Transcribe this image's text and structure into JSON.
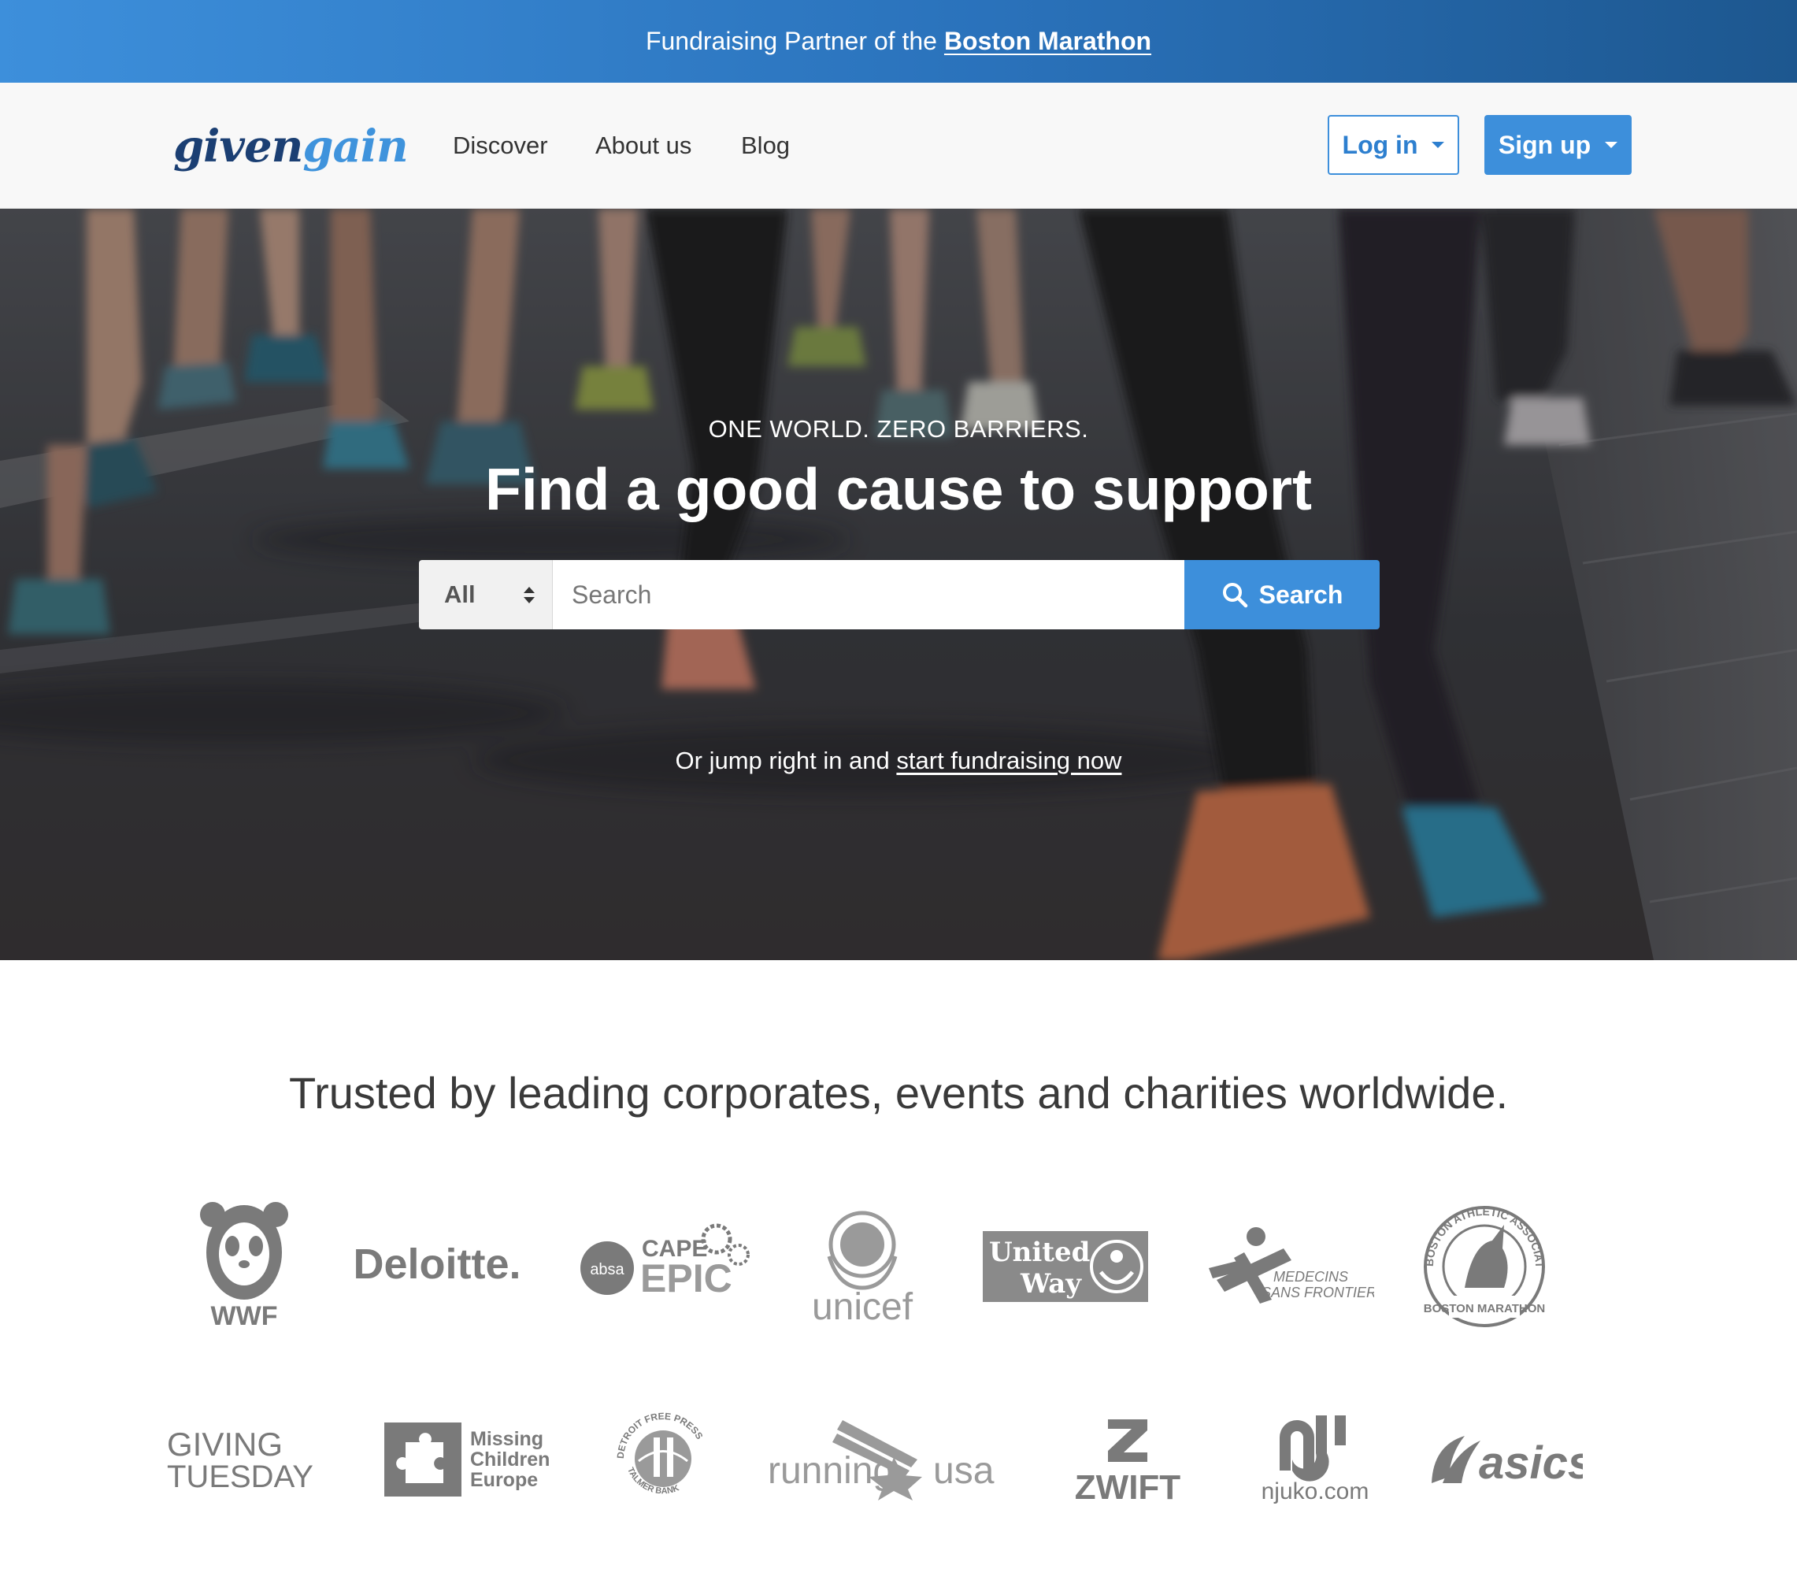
{
  "promo": {
    "prefix": "Fundraising Partner of the",
    "link": "Boston Marathon"
  },
  "navbar": {
    "logo": {
      "part1": "given",
      "part2": "gain"
    },
    "links": [
      {
        "label": "Discover"
      },
      {
        "label": "About us"
      },
      {
        "label": "Blog"
      }
    ],
    "login_label": "Log in",
    "signup_label": "Sign up"
  },
  "hero": {
    "tagline": "ONE WORLD. ZERO BARRIERS.",
    "title": "Find a good cause to support",
    "search": {
      "category": "All",
      "placeholder": "Search",
      "button_label": "Search"
    },
    "cta_prefix": "Or jump right in and",
    "cta_link": "start fundraising now"
  },
  "trusted": {
    "heading": "Trusted by leading corporates, events and charities worldwide.",
    "logos_row1": [
      {
        "name": "WWF",
        "text": "WWF"
      },
      {
        "name": "Deloitte",
        "text": "Deloitte."
      },
      {
        "name": "absa Cape Epic",
        "text1": "absa",
        "text2": "CAPE",
        "text3": "EPIC"
      },
      {
        "name": "unicef",
        "text": "unicef"
      },
      {
        "name": "United Way",
        "text1": "United",
        "text2": "Way"
      },
      {
        "name": "Medecins Sans Frontieres",
        "text1": "MEDECINS",
        "text2": "SANS FRONTIERES"
      },
      {
        "name": "Boston Athletic Association",
        "text1": "BOSTON ATHLETIC ASSOCIATION",
        "text2": "BOSTON MARATHON"
      }
    ],
    "logos_row2": [
      {
        "name": "Giving Tuesday",
        "text1": "GIVING",
        "text2": "TUESDAY"
      },
      {
        "name": "Missing Children Europe",
        "text1": "Missing",
        "text2": "Children",
        "text3": "Europe"
      },
      {
        "name": "Detroit Free Press Marathon",
        "text1": "DETROIT FREE PRESS",
        "text2": "TALMER BANK"
      },
      {
        "name": "Running USA",
        "text1": "running",
        "text2": "usa"
      },
      {
        "name": "Zwift",
        "text": "ZWIFT"
      },
      {
        "name": "njuko",
        "text": "njuko.com"
      },
      {
        "name": "asics",
        "text": "asics"
      }
    ]
  },
  "colors": {
    "brand_blue": "#3d8fdb",
    "brand_navy": "#1b3f73",
    "logo_gray": "#7a7a7a"
  }
}
